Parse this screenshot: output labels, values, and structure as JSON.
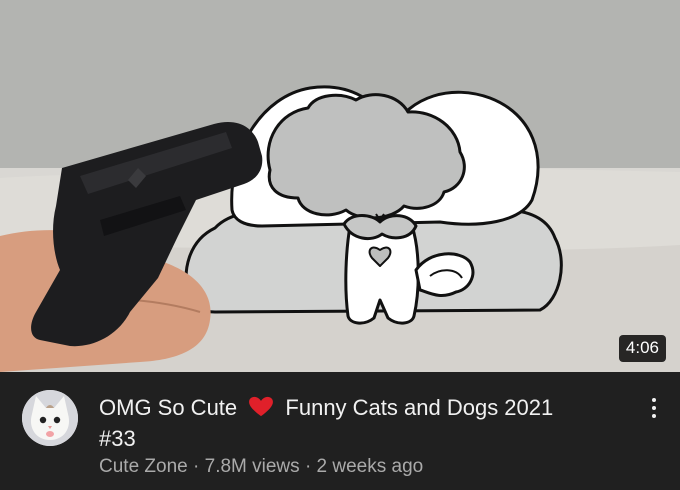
{
  "video": {
    "duration": "4:06",
    "title_part1": "OMG So Cute",
    "title_emoji": "red-heart",
    "title_part2": "Funny Cats and Dogs 2021",
    "title_line2": "#33",
    "channel": "Cute Zone",
    "separator": "·",
    "views": "7.8M views",
    "age": "2 weeks ago"
  },
  "icons": {
    "menu": "more-vertical-icon",
    "heart": "red-heart-emoji"
  },
  "colors": {
    "background": "#202020",
    "title": "#f1f1f1",
    "secondary": "#aaaaaa",
    "heart": "#e0202a"
  }
}
